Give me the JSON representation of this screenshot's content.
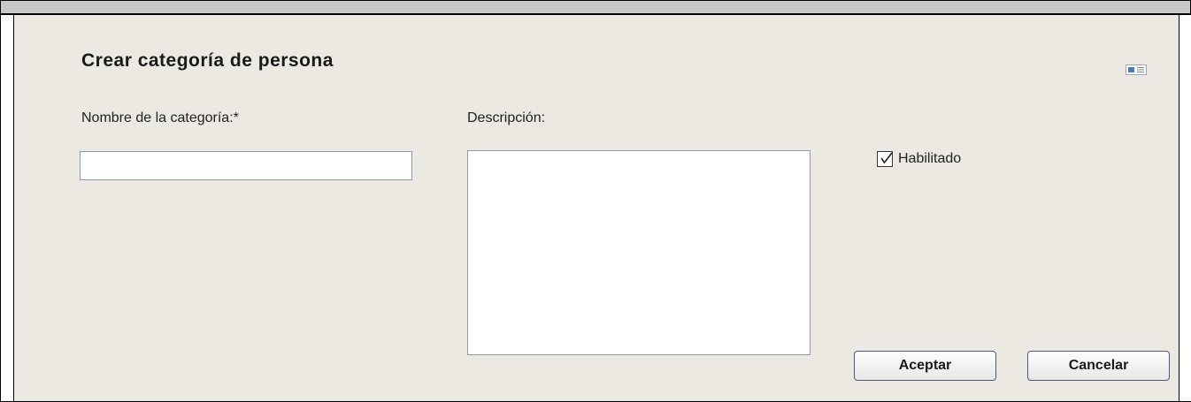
{
  "dialog": {
    "title": "Crear categoría de persona",
    "icon": "card-icon"
  },
  "form": {
    "name_label": "Nombre de la categoría:*",
    "name_value": "",
    "description_label": "Descripción:",
    "description_value": "",
    "enabled_label": "Habilitado",
    "enabled_checked": true
  },
  "buttons": {
    "accept_label": "Aceptar",
    "cancel_label": "Cancelar"
  },
  "colors": {
    "panel_background": "#ece9e3",
    "top_bar": "#c8c8c8",
    "input_border": "#8a9bb2",
    "button_border": "#4a5a78"
  }
}
